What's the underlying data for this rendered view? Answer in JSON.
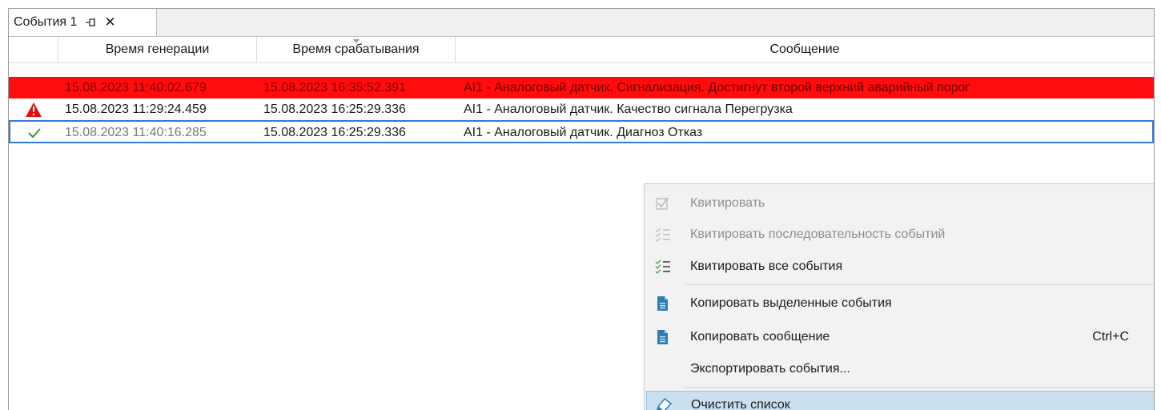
{
  "tab": {
    "title": "События 1"
  },
  "columns": {
    "gen_time": "Время генерации",
    "trig_time": "Время срабатывания",
    "message": "Сообщение"
  },
  "rows": [
    {
      "gen_time": "15.08.2023 11:40:02.679",
      "trig_time": "15.08.2023 16:35:52.391",
      "message": "AI1 - Аналоговый датчик. Сигнализация. Достигнут второй верхний аварийный порог",
      "icon": "none",
      "state": "alarm-red"
    },
    {
      "gen_time": "15.08.2023 11:29:24.459",
      "trig_time": "15.08.2023 16:25:29.336",
      "message": "AI1 - Аналоговый датчик. Качество сигнала Перегрузка",
      "icon": "warning-triangle-icon",
      "state": "normal"
    },
    {
      "gen_time": "15.08.2023 11:40:16.285",
      "trig_time": "15.08.2023 16:25:29.336",
      "message": "AI1 - Аналоговый датчик. Диагноз Отказ",
      "icon": "check-icon",
      "state": "selected-acknowledged"
    }
  ],
  "context_menu": {
    "acknowledge": "Квитировать",
    "acknowledge_sequence": "Квитировать последовательность событий",
    "acknowledge_all": "Квитировать все события",
    "copy_selected": "Копировать выделенные события",
    "copy_message": "Копировать сообщение",
    "copy_message_shortcut": "Ctrl+C",
    "export": "Экспортировать события...",
    "clear": "Очистить список"
  },
  "colors": {
    "alarm_row": "#ff0c0c",
    "selection_border": "#2f7bd8",
    "menu_hover": "#c9e0f1",
    "ack_green": "#2e9b3a",
    "warning_red": "#e01010"
  }
}
